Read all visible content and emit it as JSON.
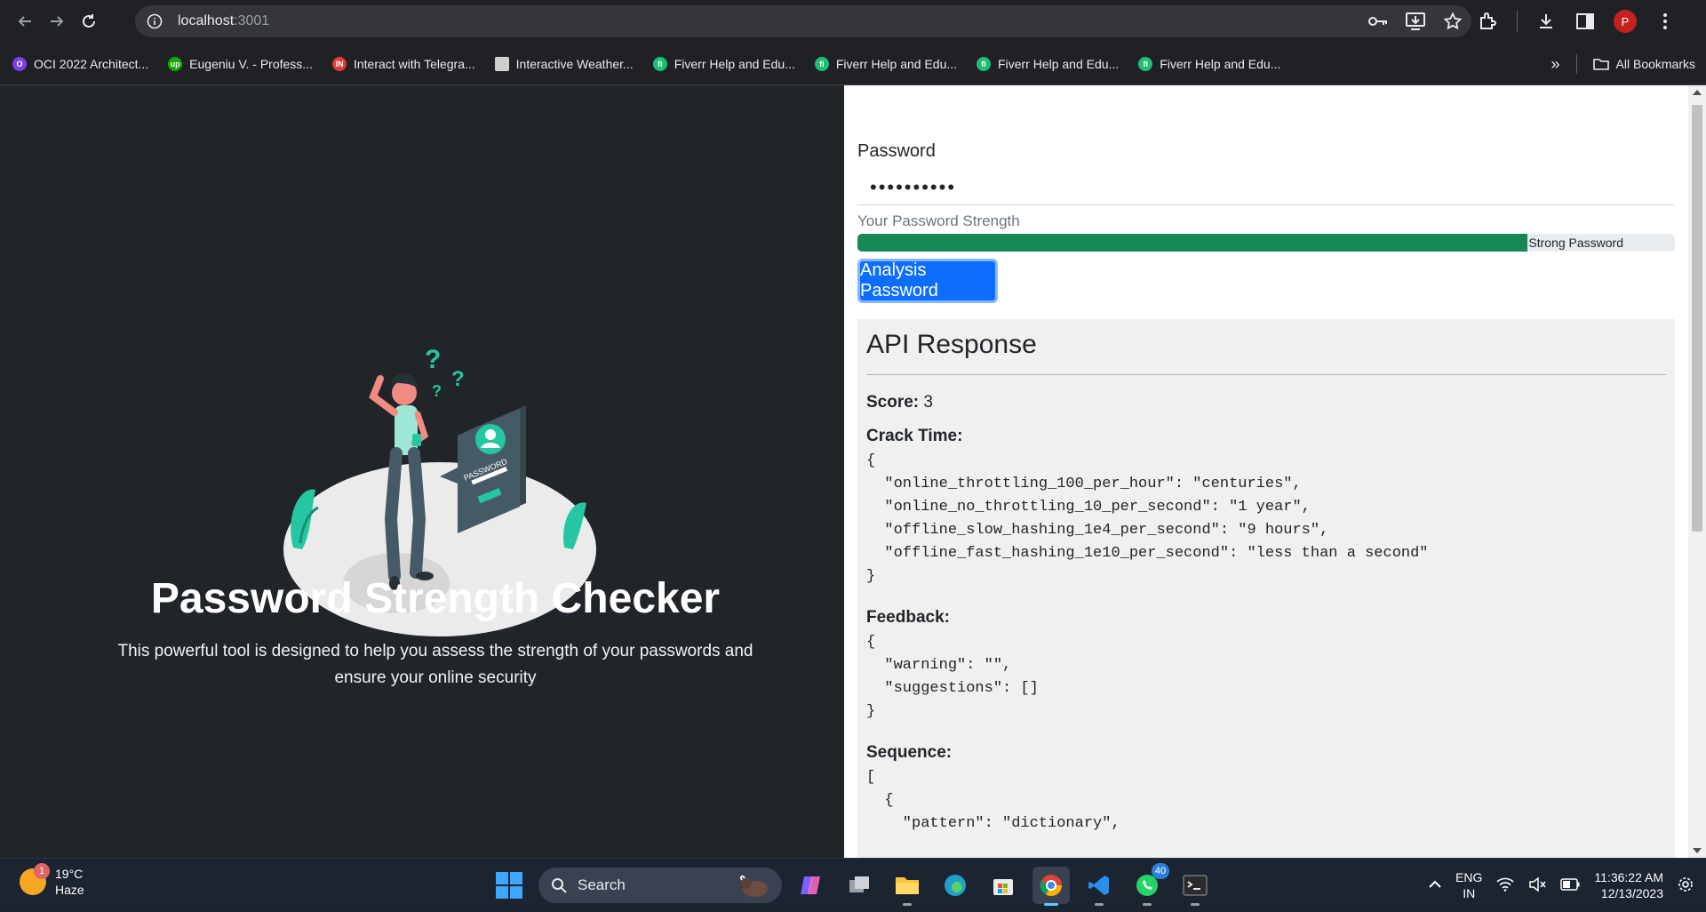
{
  "browser": {
    "url_host": "localhost",
    "url_port": ":3001",
    "profile_initial": "P",
    "bookmarks": [
      {
        "label": "OCI 2022 Architect...",
        "color": "#7b3fe4",
        "glyph": "O"
      },
      {
        "label": "Eugeniu V. - Profess...",
        "color": "#14a800",
        "glyph": "up"
      },
      {
        "label": "Interact with Telegra...",
        "color": "#e53935",
        "glyph": "IN"
      },
      {
        "label": "Interactive Weather...",
        "color": "#d0d0d0",
        "glyph": ""
      },
      {
        "label": "Fiverr Help and Edu...",
        "color": "#1dbf73",
        "glyph": "fi"
      },
      {
        "label": "Fiverr Help and Edu...",
        "color": "#1dbf73",
        "glyph": "fi"
      },
      {
        "label": "Fiverr Help and Edu...",
        "color": "#1dbf73",
        "glyph": "fi"
      },
      {
        "label": "Fiverr Help and Edu...",
        "color": "#1dbf73",
        "glyph": "fi"
      }
    ],
    "all_bookmarks": "All Bookmarks"
  },
  "hero": {
    "title": "Password Strength Checker",
    "subtitle": "This powerful tool is designed to help you assess the strength of your passwords and ensure your online security",
    "illustration_text": "PASSWORD"
  },
  "form": {
    "password_label": "Password",
    "password_value": "••••••••••",
    "strength_label": "Your Password Strength",
    "strength_text": "Strong Password",
    "strength_fraction": 0.82,
    "analyze_button": "Analysis Password"
  },
  "api": {
    "title": "API Response",
    "score_label": "Score:",
    "score_value": "3",
    "crack_time_label": "Crack Time:",
    "crack_time_json": "{\n  \"online_throttling_100_per_hour\": \"centuries\",\n  \"online_no_throttling_10_per_second\": \"1 year\",\n  \"offline_slow_hashing_1e4_per_second\": \"9 hours\",\n  \"offline_fast_hashing_1e10_per_second\": \"less than a second\"\n}",
    "feedback_label": "Feedback:",
    "feedback_json": "{\n  \"warning\": \"\",\n  \"suggestions\": []\n}",
    "sequence_label": "Sequence:",
    "sequence_json": "[\n  {\n    \"pattern\": \"dictionary\","
  },
  "taskbar": {
    "weather_temp": "19°C",
    "weather_cond": "Haze",
    "weather_badge": "1",
    "search_label": "Search",
    "whatsapp_count": "40",
    "lang_line1": "ENG",
    "lang_line2": "IN",
    "time": "11:36:22 AM",
    "date": "12/13/2023"
  }
}
